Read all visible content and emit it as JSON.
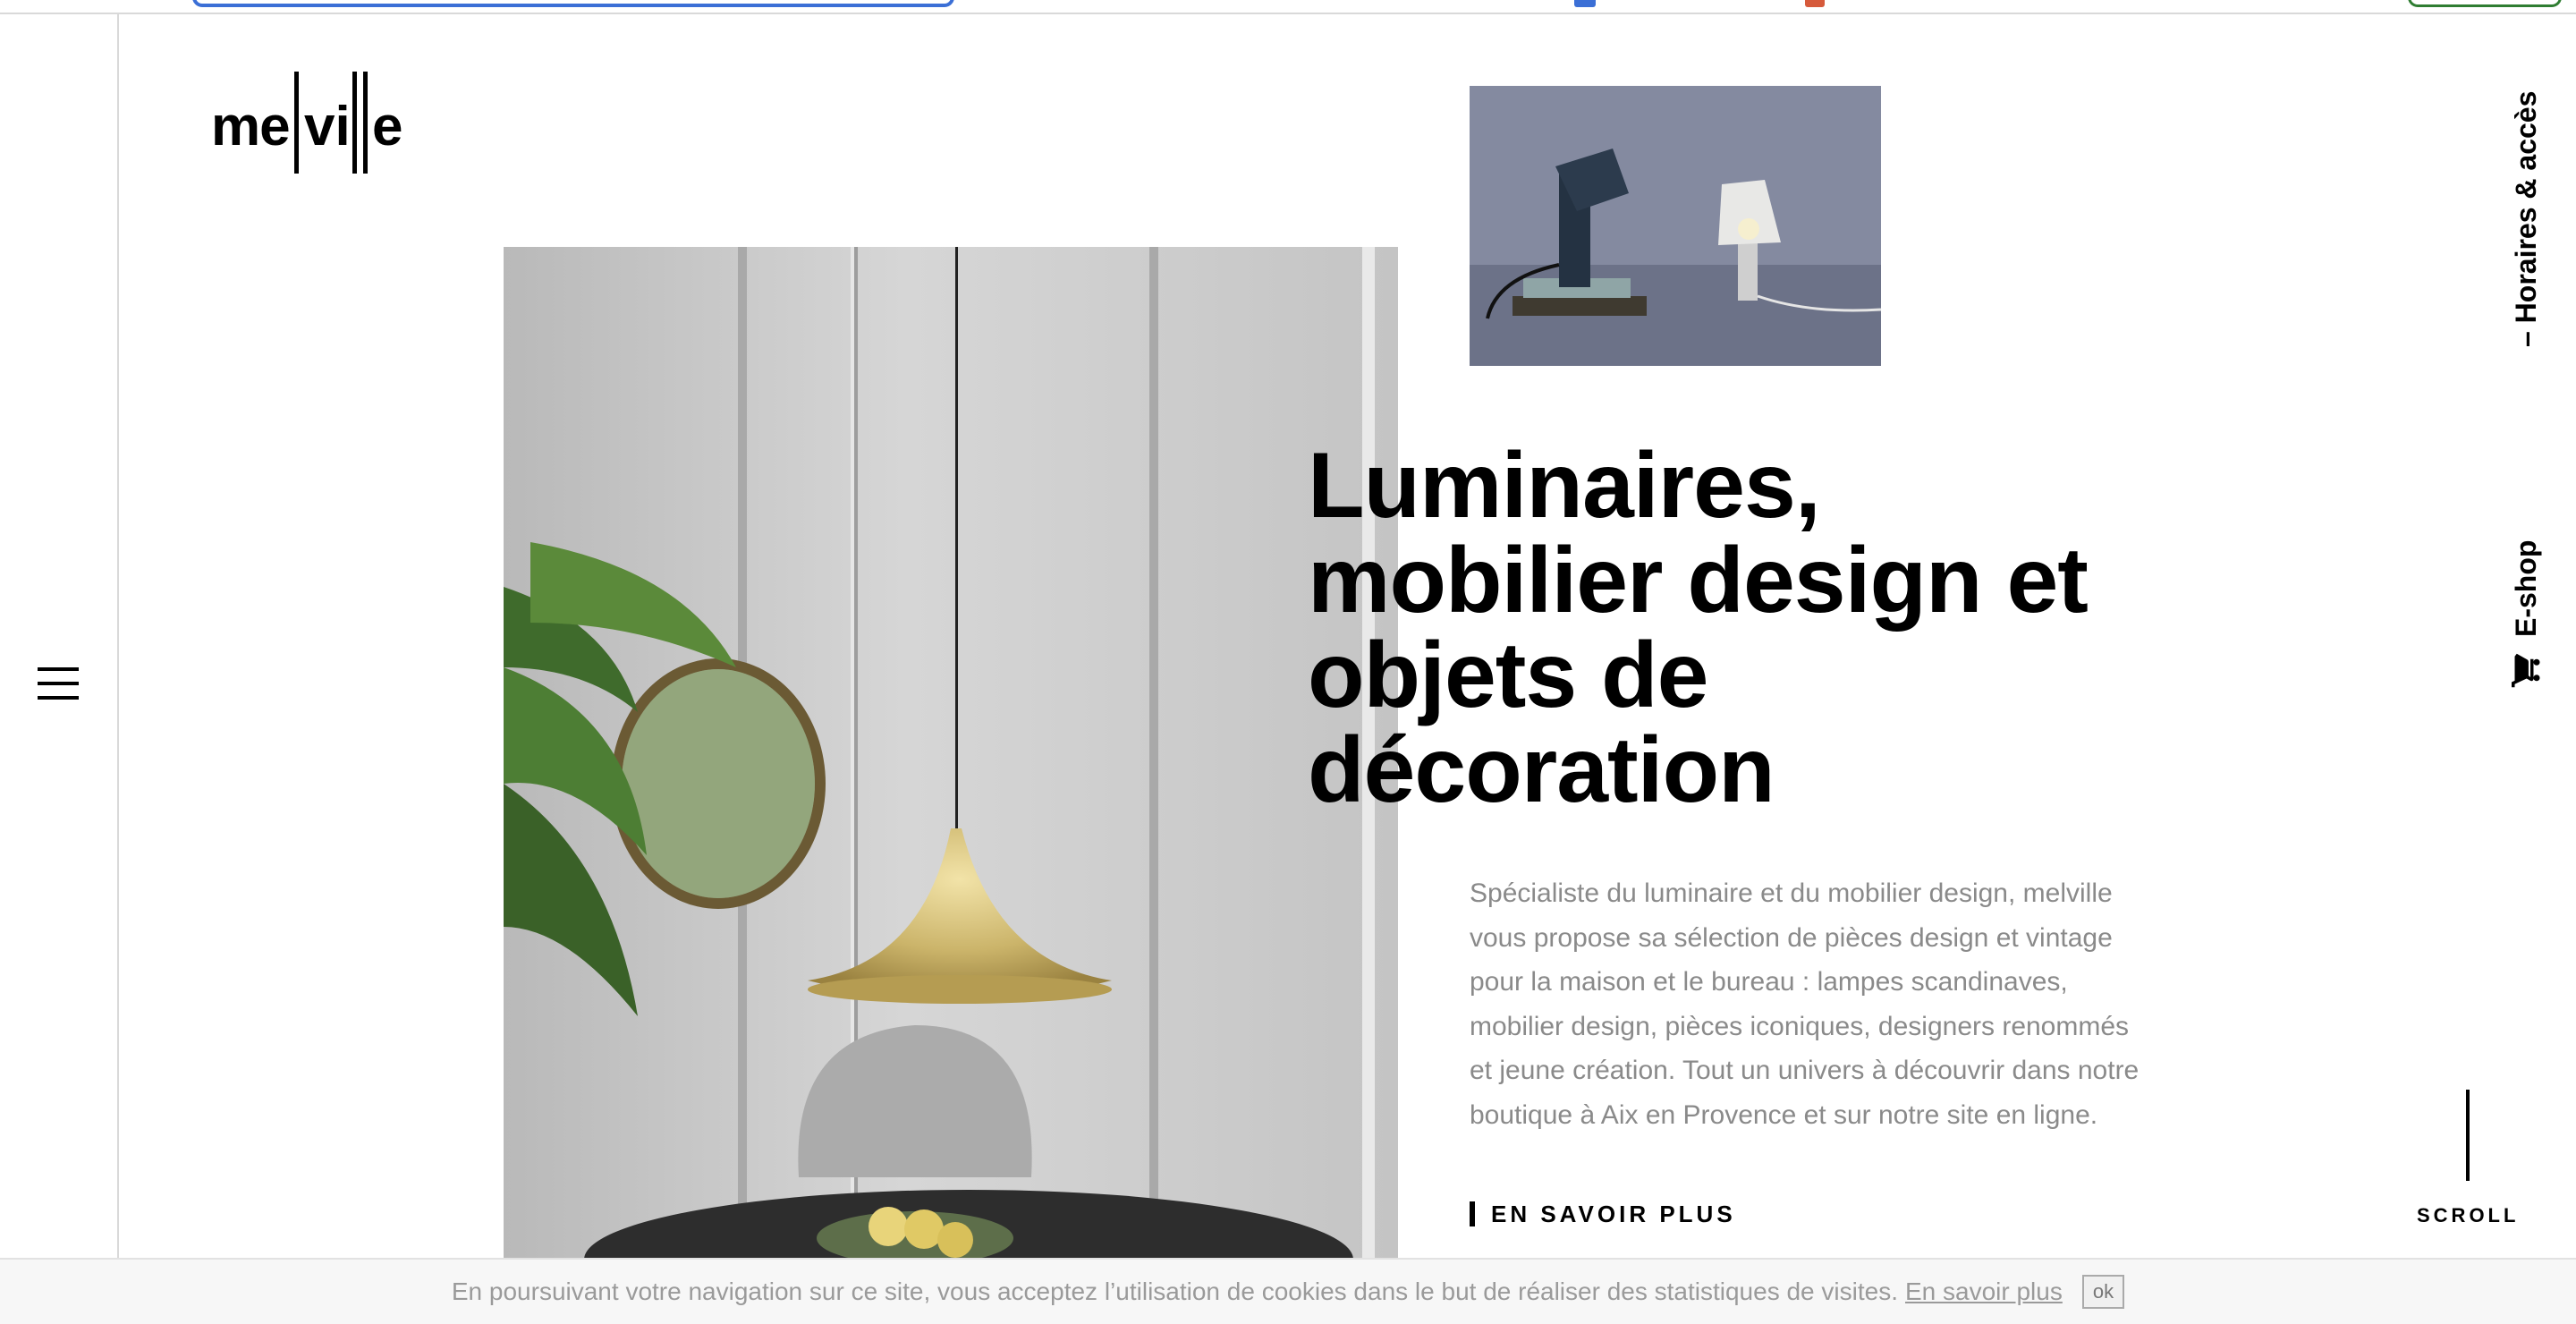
{
  "logo": {
    "text": "melville"
  },
  "nav": {
    "menu_icon": "hamburger-menu-icon"
  },
  "hero": {
    "headline": [
      "Luminaires,",
      "mobilier design et",
      "objets de",
      "décoration"
    ],
    "intro": [
      "Spécialiste du luminaire et du mobilier design, melville",
      "vous propose sa sélection de pièces design et vintage",
      "pour la maison et le bureau : lampes scandinaves,",
      "mobilier design, pièces iconiques, designers renommés",
      "et jeune création. Tout un univers à découvrir dans notre",
      "boutique à Aix en Provence et sur notre site en ligne."
    ],
    "cta_label": "EN SAVOIR PLUS"
  },
  "side_links": {
    "hours_label": "– Horaires & accès",
    "shop_label": "E-shop",
    "cart_icon": "shopping-cart-icon"
  },
  "scroll": {
    "label": "SCROLL"
  },
  "cookie": {
    "message": "En poursuivant votre navigation sur ce site, vous acceptez l’utilisation de cookies dans le but de réaliser des statistiques de visites.",
    "link_label": "En savoir plus",
    "ok_label": "ok"
  },
  "colors": {
    "text": "#000000",
    "muted": "#8a8a8a",
    "background": "#ffffff"
  }
}
